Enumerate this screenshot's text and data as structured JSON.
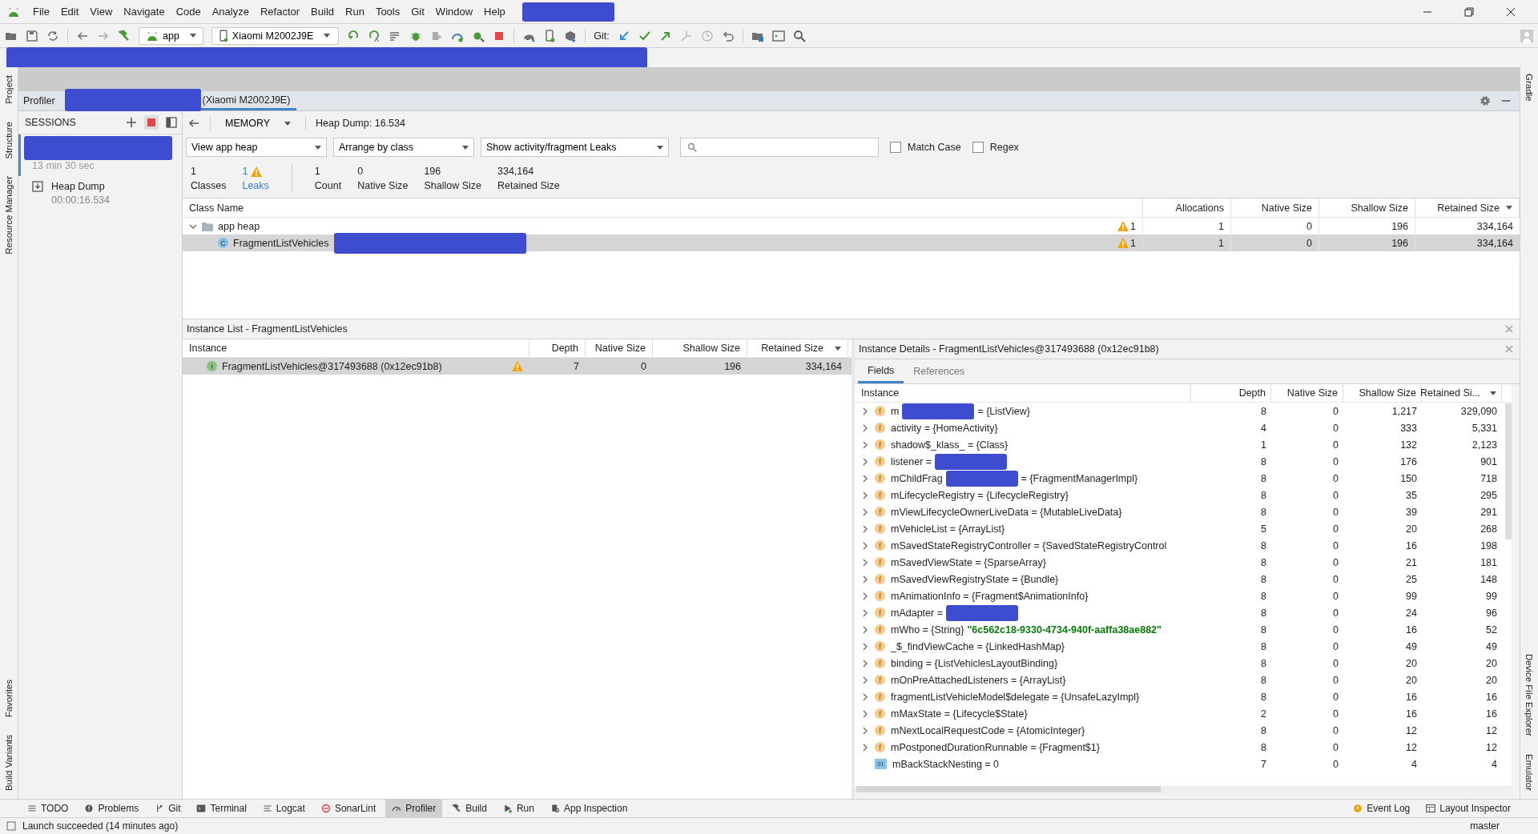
{
  "menu": [
    "File",
    "Edit",
    "View",
    "Navigate",
    "Code",
    "Analyze",
    "Refactor",
    "Build",
    "Run",
    "Tools",
    "Git",
    "Window",
    "Help"
  ],
  "toolbar": {
    "module": "app",
    "device": "Xiaomi M2002J9E",
    "git_label": "Git:"
  },
  "left_strip": [
    "Project",
    "Structure",
    "Resource Manager",
    "Favorites",
    "Build Variants"
  ],
  "right_strip": [
    "Gradle",
    "Device File Explorer",
    "Emulator"
  ],
  "profiler": {
    "title": "Profiler",
    "session_tab": "(Xiaomi M2002J9E)"
  },
  "sessions": {
    "title": "SESSIONS",
    "recording": true,
    "items": [
      {
        "kind": "session",
        "duration": "13 min 30 sec",
        "selected": true
      },
      {
        "kind": "heap_dump",
        "label": "Heap Dump",
        "time": "00:00:16.534",
        "selected": false
      }
    ]
  },
  "memory": {
    "profiler": "MEMORY",
    "heap_dump": "Heap Dump: 16.534",
    "filters": [
      "View app heap",
      "Arrange by class",
      "Show activity/fragment Leaks"
    ],
    "match_case": {
      "label": "Match Case",
      "checked": false
    },
    "regex": {
      "label": "Regex",
      "checked": false
    },
    "stats": [
      {
        "kind": "plain",
        "value": "1",
        "label": "Classes"
      },
      {
        "kind": "leak",
        "value": "1",
        "label": "Leaks"
      },
      {
        "kind": "plain",
        "value": "1",
        "label": "Count"
      },
      {
        "kind": "plain",
        "value": "0",
        "label": "Native Size"
      },
      {
        "kind": "plain",
        "value": "196",
        "label": "Shallow Size"
      },
      {
        "kind": "plain",
        "value": "334,164",
        "label": "Retained Size"
      }
    ]
  },
  "class_table": {
    "columns": [
      "Class Name",
      "Allocations",
      "Native Size",
      "Shallow Size",
      "Retained Size"
    ],
    "rows": [
      {
        "kind": "heap",
        "name": "app heap",
        "expanded": true,
        "selected": false,
        "leaks": "1",
        "allocations": "1",
        "native": "0",
        "shallow": "196",
        "retained": "334,164",
        "children": [
          {
            "kind": "class",
            "icon": "C",
            "name": "FragmentListVehicles",
            "selected": true,
            "redacted": true,
            "leaks": "1",
            "allocations": "1",
            "native": "0",
            "shallow": "196",
            "retained": "334,164"
          }
        ]
      }
    ]
  },
  "instance_list": {
    "title": "Instance List - FragmentListVehicles",
    "columns": [
      "Instance",
      "Depth",
      "Native Size",
      "Shallow Size",
      "Retained Size"
    ],
    "rows": [
      {
        "icon": "I",
        "name": "FragmentListVehicles@317493688 (0x12ec91b8)",
        "leak": true,
        "selected": true,
        "depth": "7",
        "native": "0",
        "shallow": "196",
        "retained": "334,164"
      }
    ]
  },
  "instance_details": {
    "title": "Instance Details - FragmentListVehicles@317493688 (0x12ec91b8)",
    "tabs": [
      {
        "label": "Fields",
        "selected": true
      },
      {
        "label": "References",
        "selected": false
      }
    ],
    "columns": [
      "Instance",
      "Depth",
      "Native Size",
      "Shallow Size",
      "Retained Si..."
    ],
    "rows": [
      {
        "icon": "f",
        "expandable": true,
        "label": "m",
        "redacted": true,
        "after": "= {ListView}",
        "depth": "8",
        "native": "0",
        "shallow": "1,217",
        "retained": "329,090"
      },
      {
        "icon": "f",
        "expandable": true,
        "label": "activity = {HomeActivity}",
        "redacted": false,
        "depth": "4",
        "native": "0",
        "shallow": "333",
        "retained": "5,331"
      },
      {
        "icon": "f",
        "expandable": true,
        "label": "shadow$_klass_ = {Class}",
        "redacted": false,
        "depth": "1",
        "native": "0",
        "shallow": "132",
        "retained": "2,123"
      },
      {
        "icon": "f",
        "expandable": true,
        "label": "listener =",
        "redacted": true,
        "depth": "8",
        "native": "0",
        "shallow": "176",
        "retained": "901"
      },
      {
        "icon": "f",
        "expandable": true,
        "label": "mChildFrag",
        "redacted": true,
        "after": "= {FragmentManagerImpl}",
        "depth": "8",
        "native": "0",
        "shallow": "150",
        "retained": "718"
      },
      {
        "icon": "f",
        "expandable": true,
        "label": "mLifecycleRegistry = {LifecycleRegistry}",
        "redacted": false,
        "depth": "8",
        "native": "0",
        "shallow": "35",
        "retained": "295"
      },
      {
        "icon": "f",
        "expandable": true,
        "label": "mViewLifecycleOwnerLiveData = {MutableLiveData}",
        "redacted": false,
        "depth": "8",
        "native": "0",
        "shallow": "39",
        "retained": "291"
      },
      {
        "icon": "f",
        "expandable": true,
        "label": "mVehicleList = {ArrayList}",
        "redacted": false,
        "depth": "5",
        "native": "0",
        "shallow": "20",
        "retained": "268"
      },
      {
        "icon": "f",
        "expandable": true,
        "label": "mSavedStateRegistryController = {SavedStateRegistryControl",
        "redacted": false,
        "depth": "8",
        "native": "0",
        "shallow": "16",
        "retained": "198"
      },
      {
        "icon": "f",
        "expandable": true,
        "label": "mSavedViewState = {SparseArray}",
        "redacted": false,
        "depth": "8",
        "native": "0",
        "shallow": "21",
        "retained": "181"
      },
      {
        "icon": "f",
        "expandable": true,
        "label": "mSavedViewRegistryState = {Bundle}",
        "redacted": false,
        "depth": "8",
        "native": "0",
        "shallow": "25",
        "retained": "148"
      },
      {
        "icon": "f",
        "expandable": true,
        "label": "mAnimationInfo = {Fragment$AnimationInfo}",
        "redacted": false,
        "depth": "8",
        "native": "0",
        "shallow": "99",
        "retained": "99"
      },
      {
        "icon": "f",
        "expandable": true,
        "label": "mAdapter =",
        "redacted": true,
        "depth": "8",
        "native": "0",
        "shallow": "24",
        "retained": "96"
      },
      {
        "icon": "f",
        "expandable": true,
        "label": "mWho = {String}",
        "redacted": false,
        "string": "\"6c562c18-9330-4734-940f-aaffa38ae882\"",
        "depth": "8",
        "native": "0",
        "shallow": "16",
        "retained": "52"
      },
      {
        "icon": "f",
        "expandable": true,
        "label": "_$_findViewCache = {LinkedHashMap}",
        "redacted": false,
        "depth": "8",
        "native": "0",
        "shallow": "49",
        "retained": "49"
      },
      {
        "icon": "f",
        "expandable": true,
        "label": "binding = {ListVehiclesLayoutBinding}",
        "redacted": false,
        "depth": "8",
        "native": "0",
        "shallow": "20",
        "retained": "20"
      },
      {
        "icon": "f",
        "expandable": true,
        "label": "mOnPreAttachedListeners = {ArrayList}",
        "redacted": false,
        "depth": "8",
        "native": "0",
        "shallow": "20",
        "retained": "20"
      },
      {
        "icon": "f",
        "expandable": true,
        "label": "fragmentListVehicleModel$delegate = {UnsafeLazyImpl}",
        "redacted": false,
        "depth": "8",
        "native": "0",
        "shallow": "16",
        "retained": "16"
      },
      {
        "icon": "f",
        "expandable": true,
        "label": "mMaxState = {Lifecycle$State}",
        "redacted": false,
        "depth": "2",
        "native": "0",
        "shallow": "16",
        "retained": "16"
      },
      {
        "icon": "f",
        "expandable": true,
        "label": "mNextLocalRequestCode = {AtomicInteger}",
        "redacted": false,
        "depth": "8",
        "native": "0",
        "shallow": "12",
        "retained": "12"
      },
      {
        "icon": "f",
        "expandable": true,
        "label": "mPostponedDurationRunnable = {Fragment$1}",
        "redacted": false,
        "depth": "8",
        "native": "0",
        "shallow": "12",
        "retained": "12"
      },
      {
        "icon": "01",
        "expandable": false,
        "label": "mBackStackNesting = 0",
        "redacted": false,
        "depth": "7",
        "native": "0",
        "shallow": "4",
        "retained": "4"
      }
    ]
  },
  "tool_windows": [
    {
      "kind": "todo",
      "label": "TODO",
      "selected": false
    },
    {
      "kind": "problems",
      "label": "Problems",
      "selected": false
    },
    {
      "kind": "git",
      "label": "Git",
      "selected": false
    },
    {
      "kind": "terminal",
      "label": "Terminal",
      "selected": false
    },
    {
      "kind": "logcat",
      "label": "Logcat",
      "selected": false
    },
    {
      "kind": "sonar",
      "label": "SonarLint",
      "selected": false
    },
    {
      "kind": "profiler",
      "label": "Profiler",
      "selected": true
    },
    {
      "kind": "build",
      "label": "Build",
      "selected": false
    },
    {
      "kind": "run",
      "label": "Run",
      "selected": false
    },
    {
      "kind": "inspection",
      "label": "App Inspection",
      "selected": false
    }
  ],
  "tool_windows_right": [
    {
      "kind": "event",
      "label": "Event Log",
      "selected": false
    },
    {
      "kind": "layout",
      "label": "Layout Inspector",
      "selected": false
    }
  ],
  "status_bar": {
    "message": "Launch succeeded (14 minutes ago)",
    "branch": "master"
  }
}
